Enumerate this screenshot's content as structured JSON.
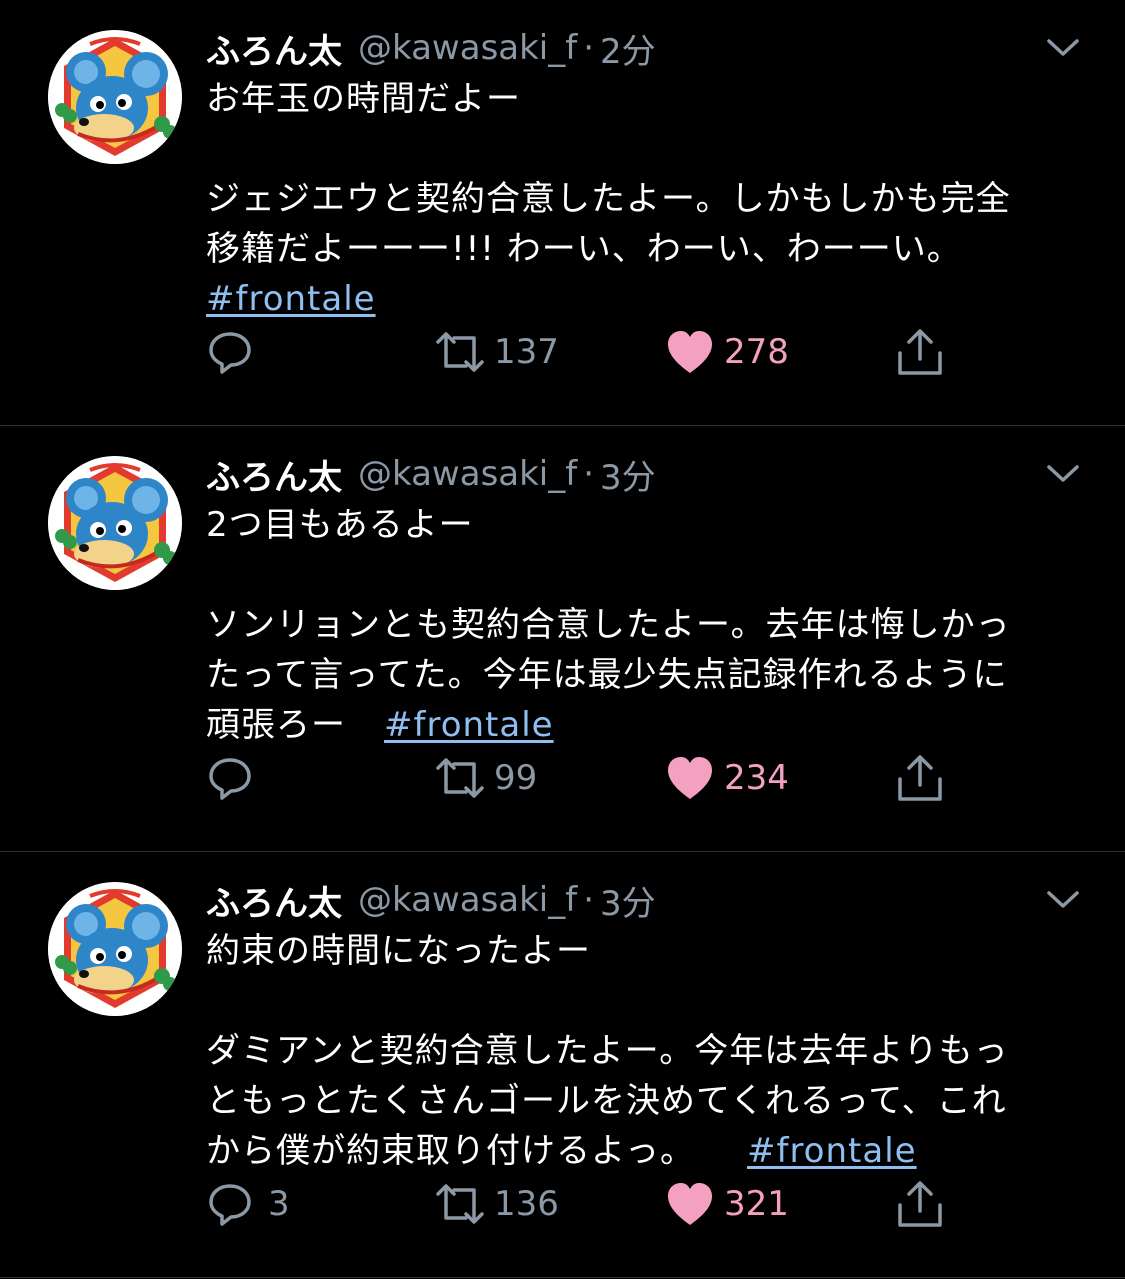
{
  "tweets": [
    {
      "name": "ふろん太",
      "handle": "@kawasaki_f",
      "separator": "·",
      "time": "2分",
      "lines_a": [
        "お年玉の時間だよー"
      ],
      "lines_b": [
        "ジェジエウと契約合意したよー。しかもしかも完全",
        "移籍だよーーー!!! わーい、わーい、わーーい。"
      ],
      "hashtag": "#frontale",
      "reply_count": "",
      "retweet_count": "137",
      "like_count": "278"
    },
    {
      "name": "ふろん太",
      "handle": "@kawasaki_f",
      "separator": "·",
      "time": "3分",
      "lines_a": [
        "2つ目もあるよー"
      ],
      "lines_b": [
        "ソンリョンとも契約合意したよー。去年は悔しかっ",
        "たって言ってた。今年は最少失点記録作れるように",
        "頑張ろー"
      ],
      "hashtag": "#frontale",
      "reply_count": "",
      "retweet_count": "99",
      "like_count": "234"
    },
    {
      "name": "ふろん太",
      "handle": "@kawasaki_f",
      "separator": "·",
      "time": "3分",
      "lines_a": [
        "約束の時間になったよー"
      ],
      "lines_b": [
        "ダミアンと契約合意したよー。今年は去年よりもっ",
        "ともっとたくさんゴールを決めてくれるって、これ",
        "から僕が約束取り付けるよっ。"
      ],
      "hashtag": "#frontale",
      "reply_count": "3",
      "retweet_count": "136",
      "like_count": "321"
    }
  ],
  "colors": {
    "background": "#000000",
    "text": "#ffffff",
    "muted": "#8b98a5",
    "hashtag": "#8fbff0",
    "like": "#f4a0c0",
    "divider": "#2f3336"
  },
  "icons": [
    "reply-icon",
    "retweet-icon",
    "like-icon",
    "share-icon",
    "chevron-down-icon"
  ]
}
